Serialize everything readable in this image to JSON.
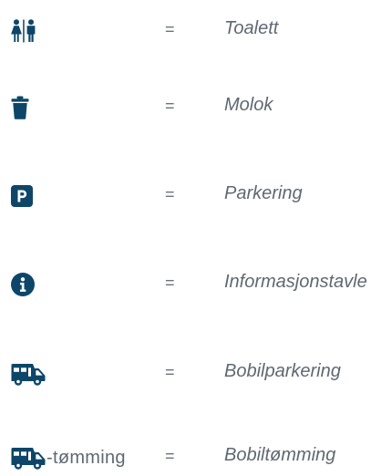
{
  "legend": {
    "items": [
      {
        "icon": "restroom-icon",
        "icon_suffix": "",
        "separator": "=",
        "label": "Toalett"
      },
      {
        "icon": "trash-can-icon",
        "icon_suffix": "",
        "separator": "=",
        "label": "Molok"
      },
      {
        "icon": "parking-icon",
        "icon_suffix": "",
        "separator": "=",
        "label": "Parkering"
      },
      {
        "icon": "info-circle-icon",
        "icon_suffix": "",
        "separator": "=",
        "label": "Informasjonstavle"
      },
      {
        "icon": "motorhome-icon",
        "icon_suffix": "",
        "separator": "=",
        "label": "Bobilparkering"
      },
      {
        "icon": "motorhome-icon",
        "icon_suffix": "-tømming",
        "separator": "=",
        "label": "Bobiltømming"
      }
    ]
  },
  "colors": {
    "icon": "#0d4668",
    "text": "#5f6872"
  }
}
